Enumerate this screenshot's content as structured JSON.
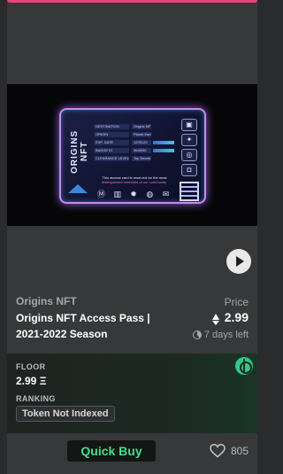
{
  "nft_image": {
    "brand": "ORIGINS NFT",
    "fields": [
      {
        "key": "DESTINATION",
        "value": "Origins NFT Beyond"
      },
      {
        "key": "ORIGIN",
        "value": "Planet Earth"
      },
      {
        "key": "EXP. DATE",
        "value": "12/31/22"
      },
      {
        "key": "BADGE ID",
        "value": "3648/30"
      },
      {
        "key": "CLEARANCE LEVEL",
        "value": "Top Secret"
      }
    ],
    "notice_prefix": "This access card is reserved for the most ",
    "notice_highlight": "distinguished members of our community.",
    "icons": [
      "M",
      "book-icon",
      "gear-icon",
      "globe-icon",
      "mail-icon"
    ],
    "side_icons": [
      "lock-icon",
      "star-icon",
      "globe-icon",
      "discord-icon"
    ]
  },
  "collection": "Origins NFT",
  "title": "Origins NFT Access Pass | 2021-2022 Season",
  "price": {
    "label": "Price",
    "value": "2.99",
    "currency_icon": "eth-icon",
    "time_left": "7 days left"
  },
  "stats": {
    "floor_label": "FLOOR",
    "floor_value": "2.99 Ξ",
    "ranking_label": "RANKING",
    "ranking_value": "Token Not Indexed"
  },
  "actions": {
    "quick_buy": "Quick Buy",
    "likes": "805"
  },
  "colors": {
    "accent_top": "#e8457a",
    "quick_buy_text": "#3fe08e",
    "marketplace_icon": "#34c68a"
  }
}
